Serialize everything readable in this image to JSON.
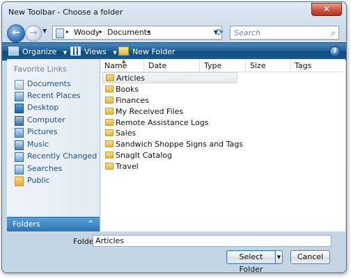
{
  "window": {
    "title": "New Toolbar - Choose a folder",
    "close_glyph": "✕"
  },
  "nav": {
    "back_glyph": "←",
    "forward_glyph": "→",
    "dropdown_glyph": "▼"
  },
  "address": {
    "crumbs": [
      "Woody",
      "Documents"
    ],
    "separator": "▸",
    "dropdown_glyph": "▼"
  },
  "search": {
    "placeholder": "Search",
    "icon": "search-icon",
    "refresh_icon": "refresh-icon"
  },
  "toolbar": {
    "organize_label": "Organize",
    "views_label": "Views",
    "new_folder_label": "New Folder",
    "dropdown_glyph": "▼",
    "help_glyph": "?",
    "color": "#1d5c93"
  },
  "favorites": {
    "title": "Favorite Links",
    "items": [
      {
        "label": "Documents",
        "icon": "documents-icon"
      },
      {
        "label": "Recent Places",
        "icon": "recent-places-icon"
      },
      {
        "label": "Desktop",
        "icon": "desktop-icon"
      },
      {
        "label": "Computer",
        "icon": "computer-icon"
      },
      {
        "label": "Pictures",
        "icon": "pictures-icon"
      },
      {
        "label": "Music",
        "icon": "music-icon"
      },
      {
        "label": "Recently Changed",
        "icon": "recently-changed-icon"
      },
      {
        "label": "Searches",
        "icon": "searches-icon"
      },
      {
        "label": "Public",
        "icon": "public-folder-icon"
      }
    ],
    "folders_label": "Folders",
    "folders_chevron": "⌃"
  },
  "files": {
    "columns": [
      "Name",
      "Date modified",
      "Type",
      "Size",
      "Tags"
    ],
    "sort_glyph": "▲",
    "items": [
      "Articles",
      "Books",
      "Finances",
      "My Received Files",
      "Remote Assistance Logs",
      "Sales",
      "Sandwich Shoppe Signs and Tags",
      "SnagIt Catalog",
      "Travel"
    ],
    "selected": "Articles"
  },
  "bottom": {
    "folder_label": "Folder:",
    "folder_value": "Articles",
    "select_button": "Select Folder",
    "split_glyph": "▼",
    "cancel_button": "Cancel"
  }
}
